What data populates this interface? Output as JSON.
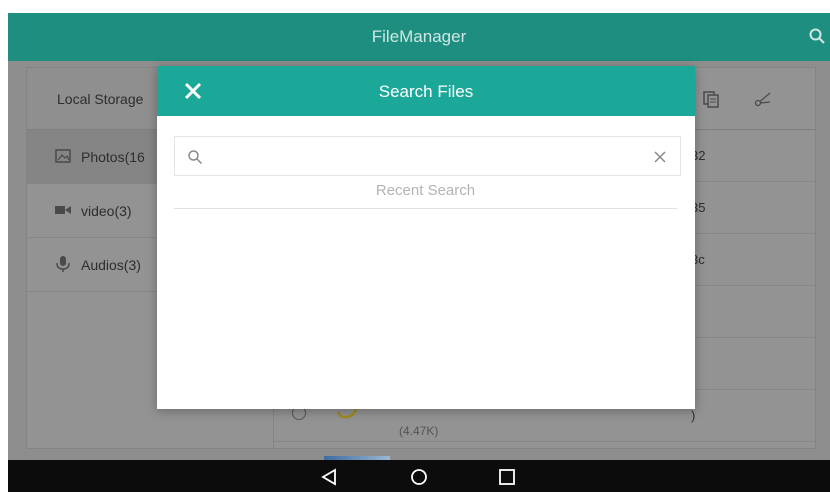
{
  "appbar": {
    "title": "FileManager"
  },
  "sidebar": {
    "header": "Local Storage",
    "items": [
      {
        "label": "Photos(16",
        "icon": "photo-icon"
      },
      {
        "label": "video(3)",
        "icon": "video-icon"
      },
      {
        "label": "Audios(3)",
        "icon": "microphone-icon"
      }
    ]
  },
  "file_list": {
    "peeks": [
      "32",
      "35",
      "3c",
      ")",
      "",
      ")"
    ],
    "last_size": "(4.47K)"
  },
  "dialog": {
    "title": "Search Files",
    "search": {
      "value": "",
      "placeholder": ""
    },
    "recent_label": "Recent Search"
  },
  "colors": {
    "appbar": "#1e8e80",
    "dialog_header": "#1ba899",
    "navbar": "#0c0c0c"
  }
}
